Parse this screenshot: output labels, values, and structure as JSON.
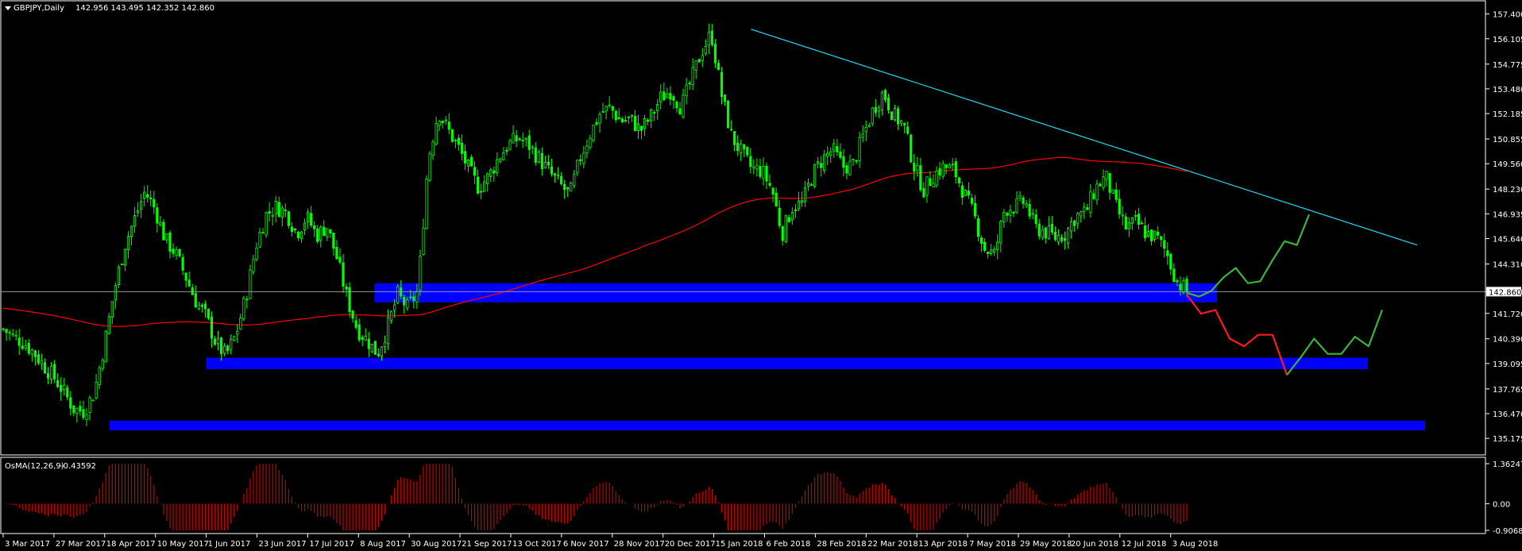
{
  "window": {
    "symbol_title": "GBPJPY,Daily",
    "ohlc_text": "142.956 143.495 142.352 142.860",
    "current_price": "142.860"
  },
  "oscillator": {
    "title": "OsMA(12,26,9)",
    "value_text": "-0.43592",
    "scale_labels": [
      "1.36247",
      "0.00",
      "-0.90686"
    ],
    "bar_color": "#cc0000"
  },
  "colors": {
    "background": "#000000",
    "candles": "#00ff00",
    "moving_average": "#ff0000",
    "trendline": "#22ccdd",
    "zones": "#0000ff",
    "projection_up": "#3cb43c",
    "projection_down": "#ff1a1a",
    "axis": "#ffffff",
    "current_price_line": "#999999"
  },
  "chart_data": {
    "type": "candlestick",
    "ylim": [
      134.6,
      157.8
    ],
    "y_tick_labels": [
      "157.400",
      "156.105",
      "154.775",
      "153.480",
      "152.185",
      "150.855",
      "149.560",
      "148.230",
      "146.935",
      "145.640",
      "144.310",
      "142.860",
      "141.720",
      "140.390",
      "139.095",
      "137.765",
      "136.470",
      "135.175"
    ],
    "x_tick_labels": [
      "3 Mar 2017",
      "27 Mar 2017",
      "18 Apr 2017",
      "10 May 2017",
      "1 Jun 2017",
      "23 Jun 2017",
      "17 Jul 2017",
      "8 Aug 2017",
      "30 Aug 2017",
      "21 Sep 2017",
      "13 Oct 2017",
      "6 Nov 2017",
      "28 Nov 2017",
      "20 Dec 2017",
      "15 Jan 2018",
      "6 Feb 2018",
      "28 Feb 2018",
      "22 Mar 2018",
      "13 Apr 2018",
      "7 May 2018",
      "29 May 2018",
      "20 Jun 2018",
      "12 Jul 2018",
      "3 Aug 2018"
    ],
    "price_path": [
      140.9,
      140.5,
      140.2,
      139.7,
      139.0,
      138.4,
      137.6,
      136.7,
      136.6,
      137.6,
      140.1,
      143.0,
      145.3,
      146.7,
      148.1,
      147.2,
      145.6,
      144.9,
      143.7,
      142.4,
      141.6,
      140.2,
      139.5,
      140.6,
      142.6,
      145.3,
      146.9,
      147.3,
      147.0,
      145.9,
      146.8,
      145.8,
      146.3,
      144.6,
      142.5,
      140.9,
      140.3,
      139.6,
      141.0,
      142.7,
      142.0,
      142.9,
      149.8,
      152.3,
      151.3,
      150.4,
      149.3,
      148.3,
      148.9,
      149.9,
      150.6,
      150.9,
      150.5,
      149.8,
      149.1,
      148.5,
      147.9,
      149.8,
      151.1,
      152.2,
      152.5,
      151.8,
      151.9,
      151.3,
      152.0,
      153.0,
      153.4,
      152.5,
      153.9,
      155.4,
      156.4,
      153.2,
      151.0,
      150.1,
      149.3,
      149.2,
      148.2,
      145.9,
      147.3,
      147.5,
      149.0,
      149.8,
      150.3,
      149.4,
      149.5,
      151.0,
      152.4,
      153.3,
      152.1,
      151.6,
      149.5,
      148.2,
      149.0,
      149.4,
      149.2,
      148.0,
      146.8,
      145.1,
      144.8,
      147.2,
      147.3,
      147.6,
      146.2,
      146.0,
      145.7,
      145.9,
      146.8,
      147.0,
      148.3,
      148.9,
      147.3,
      146.2,
      146.5,
      145.9,
      145.7,
      144.9,
      143.4,
      142.9
    ],
    "support_zones": [
      {
        "top": 143.3,
        "bottom": 142.3,
        "from": "8 Aug 2017"
      },
      {
        "top": 139.4,
        "bottom": 138.8,
        "from": "1 Jun 2017"
      },
      {
        "top": 136.1,
        "bottom": 135.6,
        "from": "18 Apr 2017"
      }
    ],
    "trendline": {
      "from": {
        "date": "6 Feb 2018",
        "price": 156.6
      },
      "to": {
        "price": 145.3
      }
    },
    "moving_average_label": "",
    "projections": [
      {
        "direction": "up",
        "path": [
          142.8,
          142.6,
          142.9,
          143.6,
          144.1,
          143.3,
          143.4,
          144.5,
          145.5,
          145.3,
          146.9
        ]
      },
      {
        "direction": "down",
        "path": [
          142.7,
          141.7,
          141.9,
          140.4,
          140.0,
          140.6,
          140.6,
          138.5
        ]
      },
      {
        "direction": "up",
        "path": [
          138.5,
          139.4,
          140.4,
          139.6,
          139.6,
          140.5,
          140.0,
          141.9
        ]
      }
    ]
  }
}
